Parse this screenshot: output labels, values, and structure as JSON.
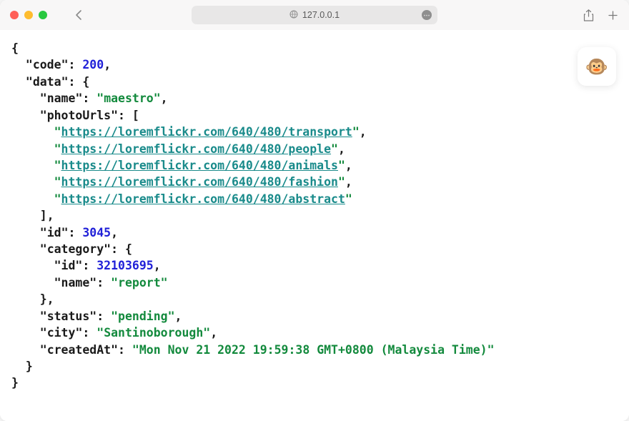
{
  "titlebar": {
    "address": "127.0.0.1"
  },
  "badge": {
    "emoji": "🐵"
  },
  "json": {
    "code": 200,
    "data": {
      "name": "maestro",
      "photoUrls": [
        "https://loremflickr.com/640/480/transport",
        "https://loremflickr.com/640/480/people",
        "https://loremflickr.com/640/480/animals",
        "https://loremflickr.com/640/480/fashion",
        "https://loremflickr.com/640/480/abstract"
      ],
      "id": 3045,
      "category": {
        "id": 32103695,
        "name": "report"
      },
      "status": "pending",
      "city": "Santinoborough",
      "createdAt": "Mon Nov 21 2022 19:59:38 GMT+0800 (Malaysia Time)"
    }
  },
  "labels": {
    "code": "code",
    "data": "data",
    "name": "name",
    "photoUrls": "photoUrls",
    "id": "id",
    "category": "category",
    "status": "status",
    "city": "city",
    "createdAt": "createdAt"
  }
}
